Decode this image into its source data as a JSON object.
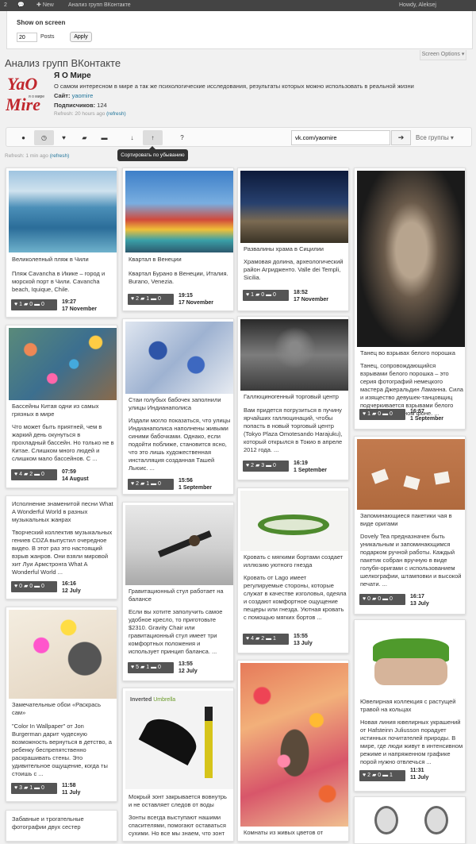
{
  "adminbar": {
    "counter": "2",
    "new": "New",
    "site": "Анализ групп ВКонтакте",
    "user": "Howdy, Aleksej"
  },
  "screen_options": {
    "title": "Show on screen",
    "per_page": "20",
    "posts_label": "Posts",
    "apply": "Apply",
    "tab": "Screen Options ▾"
  },
  "page_title": "Анализ групп ВКонтакте",
  "group": {
    "name": "Я О Мире",
    "description": "О самом интересном в мире а так же психологические исследования, результаты которых можно использовать в реальной жизни",
    "site_label": "Сайт:",
    "site": "yaomire",
    "subs_label": "Подписчиков:",
    "subs": "124",
    "refresh": "Refresh: 20 hours ago",
    "refresh_link": "(refresh)"
  },
  "logo": {
    "line1": "YaO",
    "line2": "я о мире",
    "line3": "Mire"
  },
  "toolbar": {
    "search_value": "vk.com/yaomire",
    "go": "➔",
    "groups": "Все группы ▾",
    "tooltip": "Сортировать по убыванию"
  },
  "refresh2": {
    "text": "Refresh: 1 min ago",
    "link": "(refresh)"
  },
  "cards": [
    {
      "title": "Великолепный пляж в Чили",
      "desc": "Пляж Cavancha в Икике – город и морской порт в Чили. Cavancha beach, Iquique, Chile.",
      "stats": "♥ 1 ▰ 0 ▬ 0",
      "time": "19:27",
      "date": "17 November"
    },
    {
      "title": "Квартал в Венеции",
      "desc": "Квартал Бурано в Венеции, Италия. Burano, Venezia.",
      "stats": "♥ 2 ▰ 1 ▬ 0",
      "time": "19:15",
      "date": "17 November"
    },
    {
      "title": "Развалины храма в Сицилии",
      "desc": "Храмовая долина, археологический район Агридженто. Valle dei Templi, Sicilia.",
      "stats": "♥ 1 ▰ 0 ▬ 0",
      "time": "18:52",
      "date": "17 November"
    },
    {
      "title": "Танец во взрывах белого порошка",
      "desc": "Танец, сопровождающийся взрывами белого порошка – это серия фотографий немецкого мастера Джеральдин Ламанна. Сила и изящество девушек-танцовщиц подчеркивается взрывами белого порошка на черном фоне. ...",
      "stats": "♥ 1 ▰ 0 ▬ 0",
      "time": "16:57",
      "date": "1 September"
    },
    {
      "title": "Бассейны Китая одни из самых грязных в мире",
      "desc": "Что может быть приятней, чем в жаркий день окунуться в прохладный бассейн. Но только не в Китае. Слишком много людей и слишком мало бассейнов. С ...",
      "stats": "♥ 4 ▰ 2 ▬ 0",
      "time": "07:59",
      "date": "14 August"
    },
    {
      "title": "Стаи голубых бабочек заполнили улицы Индианаполиса",
      "desc": "Издали могло показаться, что улицы Индианаполиса наполнены живыми синими бабочками. Однако, если подойти поближе, становится ясно, что это лишь художественная инсталляция созданная Ташей Льюис. ...",
      "stats": "♥ 2 ▰ 1 ▬ 0",
      "time": "15:56",
      "date": "1 September"
    },
    {
      "title": "Галлюциногенный торговый центр",
      "desc": "Вам придется погрузиться в пучину ярчайших галлюцинаций, чтобы попасть в новый торговый центр (Tokyo Plaza Omotesando Harajuku), который открылся в Токио в апреле 2012 года. ...",
      "stats": "♥ 2 ▰ 3 ▬ 0",
      "time": "16:19",
      "date": "1 September"
    },
    {
      "title": "Запоминающиеся пакетики чая в виде оригами",
      "desc": "Dovely Tea предназначен быть уникальным и запоминающимся подарком ручной работы. Каждый пакетик собран вручную в виде голубя-оригами с использованием шелкографии, штамповки и высокой печати. ...",
      "stats": "♥ 0 ▰ 0 ▬ 0",
      "time": "16:17",
      "date": "13 July"
    },
    {
      "title": "Исполнение знаменитой песни What A Wonderful World в разных музыкальных жанрах",
      "desc": "Творческий коллектив музыкальных гениев CDZA выпустил очередное видео. В этот раз это настоящий взрыв жанров. Они взяли мировой хит Луи Армстронга What A Wonderful World ...",
      "stats": "♥ 0 ▰ 0 ▬ 0",
      "time": "16:16",
      "date": "12 July"
    },
    {
      "title": "Гравитационный стул работает на балансе",
      "desc": "Если вы хотите заполучить самое удобное кресло, то приготовьте $2310. Gravity Chair или гравитационный стул имеет три комфортных положения и использует принцип баланса. ...",
      "stats": "♥ 5 ▰ 1 ▬ 0",
      "time": "13:55",
      "date": "12 July"
    },
    {
      "title": "Кровать с мягкими бортами создает иллюзию уютного гнезда",
      "desc": "Кровать от Lago имеет регулируемые стороны, которые служат в качестве изголовья, одеяла и создают комфортное ощущение пещеры или гнезда. Уютная кровать с помощью мягких бортов ...",
      "stats": "♥ 4 ▰ 2 ▬ 1",
      "time": "15:55",
      "date": "13 July"
    },
    {
      "title": "Ювелирная коллекция с растущей травой на кольцах",
      "desc": "Новая линия ювелирных украшений от Hafsteinn Juliusson порадует истинных почитателей природы. В мире, где люди живут в интенсивном режиме и напряженном графике порой нужно отвлечься ...",
      "stats": "♥ 2 ▰ 0 ▬ 1",
      "time": "11:31",
      "date": "11 July"
    },
    {
      "title": "Замечательные обои «Раскрась сам»",
      "desc": "\"Color In Wallpaper\" от Jon Burgerman дарит чудесную возможность вернуться в детство, а ребенку беспрепятственно раскрашивать стены. Это удивительное ощущение, когда ты стоишь с ...",
      "stats": "♥ 3 ▰ 1 ▬ 0",
      "time": "11:58",
      "date": "11 July"
    },
    {
      "title": "Мокрый зонт закрывается вовнутрь и не оставляет следов от воды",
      "desc": "Зонты всегда выступают нашими спасителями, помогают оставаться сухими. Но все мы знаем, что зонт",
      "stats": "",
      "time": "",
      "date": ""
    },
    {
      "title": "Комнаты из живых цветов от",
      "desc": "",
      "stats": "",
      "time": "",
      "date": ""
    },
    {
      "title": "Забавные и трогательные фотографии двух сестер",
      "desc": "",
      "stats": "",
      "time": "",
      "date": ""
    }
  ],
  "umbrella": {
    "label1": "Inverted",
    "label2": "Umbrella"
  }
}
